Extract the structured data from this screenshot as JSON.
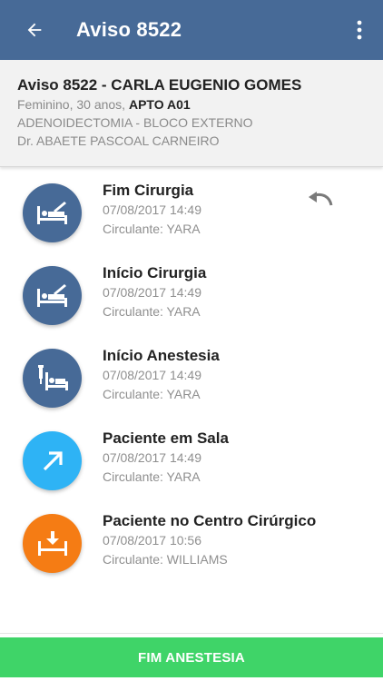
{
  "appbar": {
    "title": "Aviso 8522",
    "back_icon": "arrow-left-icon",
    "menu_icon": "more-vertical-icon",
    "color": "#476a97"
  },
  "patient": {
    "heading": "Aviso 8522 - CARLA EUGENIO GOMES",
    "demographics": "Feminino, 30 anos, ",
    "room": "APTO A01",
    "procedure": "ADENOIDECTOMIA - BLOCO EXTERNO",
    "doctor": "Dr. ABAETE PASCOAL CARNEIRO"
  },
  "events": [
    {
      "title": "Fim Cirurgia",
      "datetime": "07/08/2017 14:49",
      "staff": "Circulante: YARA",
      "icon": "bed-scalpel-icon",
      "color": "#476a97",
      "undo": true
    },
    {
      "title": "Início Cirurgia",
      "datetime": "07/08/2017 14:49",
      "staff": "Circulante: YARA",
      "icon": "bed-scalpel-icon",
      "color": "#476a97"
    },
    {
      "title": "Início Anestesia",
      "datetime": "07/08/2017 14:49",
      "staff": "Circulante: YARA",
      "icon": "iv-bed-icon",
      "color": "#476a97"
    },
    {
      "title": "Paciente em Sala",
      "datetime": "07/08/2017 14:49",
      "staff": "Circulante: YARA",
      "icon": "arrow-up-right-icon",
      "color": "#2eb3f5"
    },
    {
      "title": "Paciente no Centro Cirúrgico",
      "datetime": "07/08/2017 10:56",
      "staff": "Circulante: WILLIAMS",
      "icon": "bed-arrival-icon",
      "color": "#f57c14"
    }
  ],
  "undo_icon": "undo-icon",
  "action": {
    "label": "FIM ANESTESIA",
    "color": "#3fd468"
  }
}
